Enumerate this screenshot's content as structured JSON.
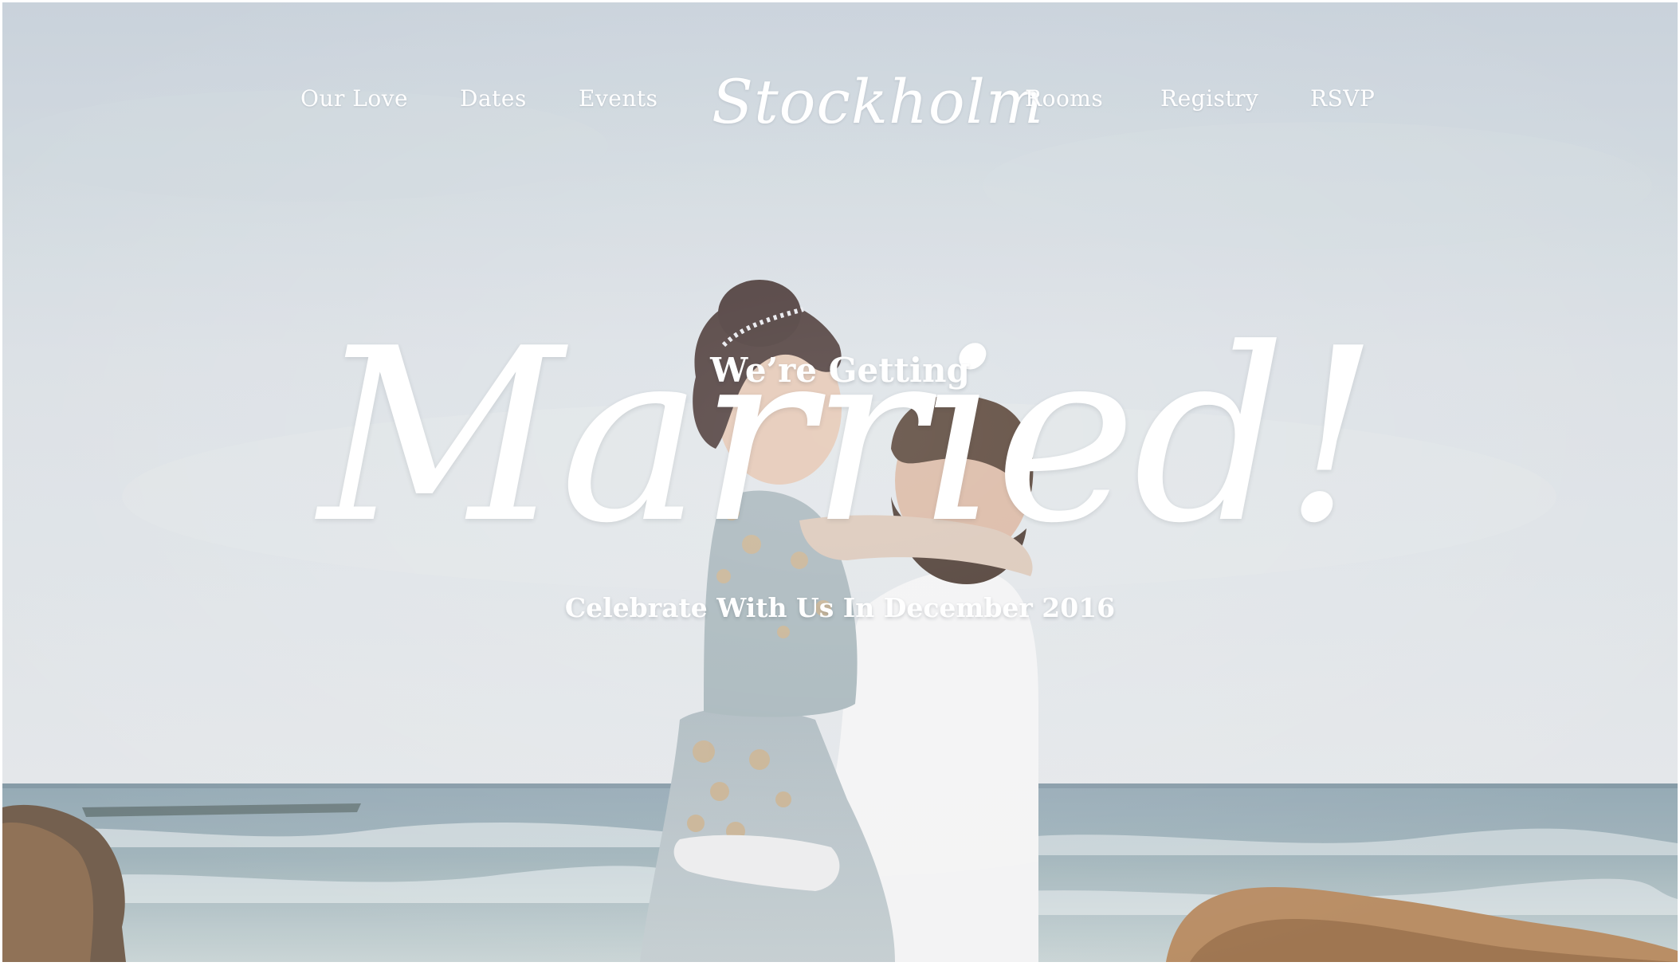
{
  "nav": {
    "left_items": [
      {
        "label": "Our Love"
      },
      {
        "label": "Dates"
      },
      {
        "label": "Events"
      }
    ],
    "logo": "Stockholm",
    "right_items": [
      {
        "label": "Rooms"
      },
      {
        "label": "Registry"
      },
      {
        "label": "RSVP"
      }
    ]
  },
  "hero": {
    "pre_title": "We’re Getting",
    "title": "Married!",
    "subtitle": "Celebrate With Us In December 2016",
    "background_image": "couple-embracing-by-the-sea-photo"
  },
  "colors": {
    "text": "#ffffff",
    "sky": "#d7dde3",
    "sea": "#8fa3ad",
    "rock": "#b88a5f"
  }
}
